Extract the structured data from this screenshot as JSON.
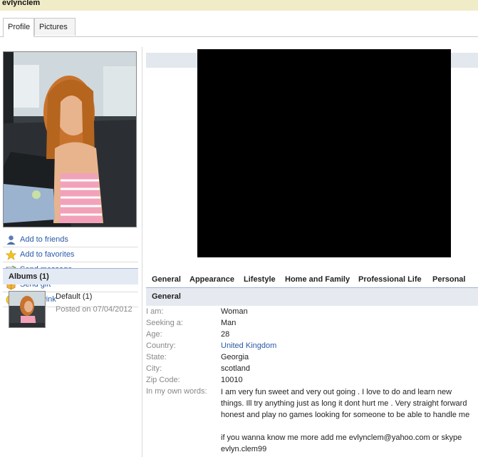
{
  "username": "evlynclem",
  "tabs": [
    {
      "label": "Profile"
    },
    {
      "label": "Pictures"
    }
  ],
  "actions": [
    {
      "label": "Add to friends",
      "icon": "person-icon"
    },
    {
      "label": "Add to favorites",
      "icon": "star-icon"
    },
    {
      "label": "Send message",
      "icon": "envelope-icon"
    },
    {
      "label": "Send gift",
      "icon": "gift-icon"
    },
    {
      "label": "Send wink",
      "icon": "smiley-icon"
    }
  ],
  "albums": {
    "heading": "Albums (1)",
    "items": [
      {
        "name": "Default (1)",
        "posted": "Posted on 07/04/2012"
      }
    ]
  },
  "section_tabs": [
    "General",
    "Appearance",
    "Lifestyle",
    "Home and Family",
    "Professional Life",
    "Personal"
  ],
  "general": {
    "heading": "General",
    "fields": [
      {
        "label": "I am:",
        "value": "Woman"
      },
      {
        "label": "Seeking a:",
        "value": "Man"
      },
      {
        "label": "Age:",
        "value": "28"
      },
      {
        "label": "Country:",
        "value": "United Kingdom"
      },
      {
        "label": "State:",
        "value": "Georgia"
      },
      {
        "label": "City:",
        "value": "scotland"
      },
      {
        "label": "Zip Code:",
        "value": "10010"
      }
    ],
    "own_words_label": "In my own words:",
    "own_words_p1": "I am very fun sweet and very out going . I love to do and learn new things. Ill try anything just as long it dont hurt me . Very straight forward honest and play no games looking for someone to be able to handle me",
    "own_words_p2": "if you wanna know me more add me evlynclem@yahoo.com or skype evlyn.clem99"
  },
  "colors": {
    "topbar": "#f1ecc8",
    "link": "#2a5aa8",
    "header_band": "#e6eaf0"
  }
}
